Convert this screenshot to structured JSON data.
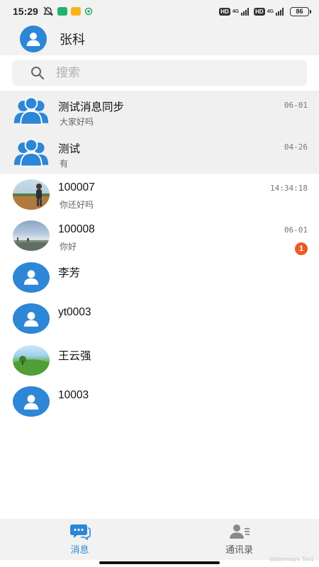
{
  "status_bar": {
    "time": "15:29",
    "network_1": "4G",
    "network_2": "4G",
    "hd_label_1": "HD",
    "hd_label_2": "HD",
    "battery": "86"
  },
  "header": {
    "user_name": "张科"
  },
  "search": {
    "placeholder": "搜索"
  },
  "colors": {
    "accent": "#2d86d6",
    "badge": "#ee5a24",
    "pinned_bg": "#f0f0f0"
  },
  "chats": [
    {
      "name": "测试消息同步",
      "preview": "大家好吗",
      "time": "06-01",
      "avatar": "group-icon",
      "pinned": true
    },
    {
      "name": "测试",
      "preview": "有",
      "time": "04-26",
      "avatar": "group-icon",
      "pinned": true
    },
    {
      "name": "100007",
      "preview": "你还好吗",
      "time": "14:34:18",
      "avatar": "photo"
    },
    {
      "name": "100008",
      "preview": "你好",
      "time": "06-01",
      "unread": "1",
      "avatar": "photo"
    },
    {
      "name": "李芳",
      "avatar": "person-icon"
    },
    {
      "name": "yt0003",
      "avatar": "person-icon"
    },
    {
      "name": "王云强",
      "avatar": "photo"
    },
    {
      "name": "10003",
      "avatar": "person-icon"
    }
  ],
  "watermark": "Watermark Text",
  "bottom_nav": {
    "messages_label": "消息",
    "contacts_label": "通讯录"
  }
}
